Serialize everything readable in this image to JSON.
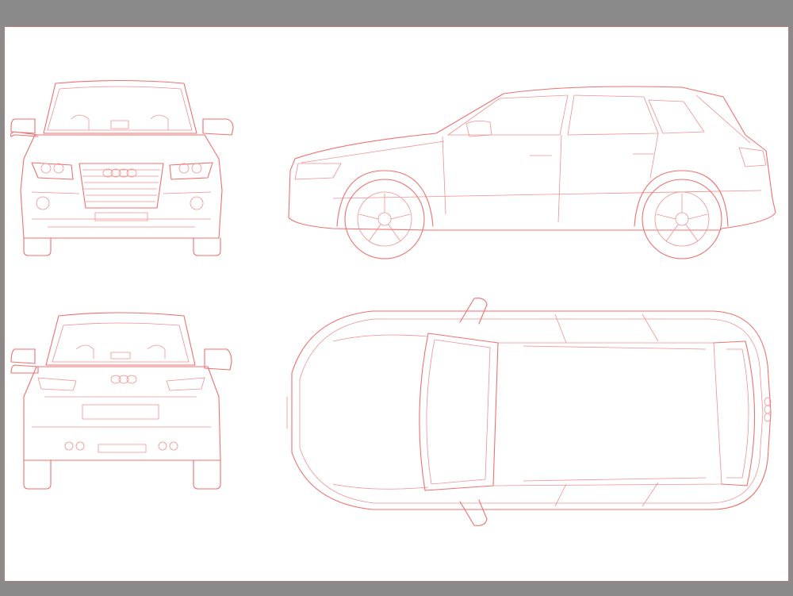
{
  "canvas": {
    "background": "#8a8a8a",
    "sheet": "#ffffff",
    "line_color": "#f07070"
  },
  "views": [
    {
      "id": "front",
      "label": ""
    },
    {
      "id": "side",
      "label": ""
    },
    {
      "id": "rear",
      "label": ""
    },
    {
      "id": "top",
      "label": ""
    }
  ]
}
